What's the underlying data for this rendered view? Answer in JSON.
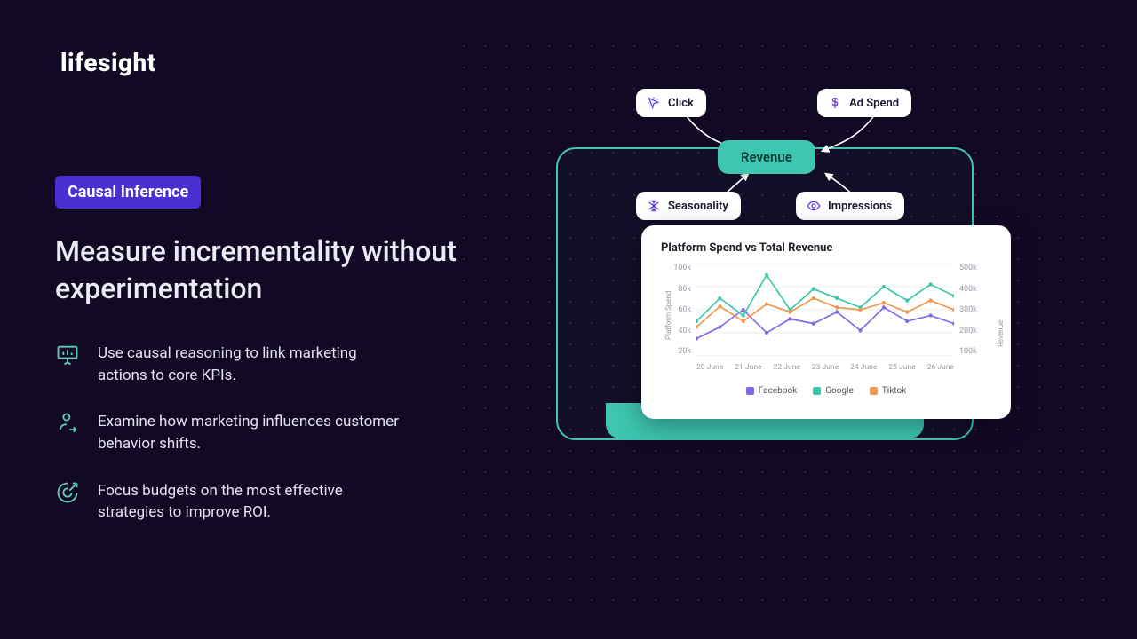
{
  "brand": {
    "name": "lifesight"
  },
  "badge": {
    "label": "Causal Inference"
  },
  "headline": "Measure incrementality without experimentation",
  "bullets": [
    {
      "text": "Use causal reasoning to link marketing actions to core KPIs."
    },
    {
      "text": "Examine how marketing influences customer behavior shifts."
    },
    {
      "text": "Focus budgets on the most effective strategies to improve ROI."
    }
  ],
  "graph_nodes": {
    "click": {
      "label": "Click",
      "icon": "cursor-icon"
    },
    "adspend": {
      "label": "Ad Spend",
      "icon": "dollar-icon"
    },
    "revenue": {
      "label": "Revenue"
    },
    "seasonality": {
      "label": "Seasonality",
      "icon": "snowflake-icon"
    },
    "impressions": {
      "label": "Impressions",
      "icon": "eye-icon"
    }
  },
  "chart_data": {
    "type": "line",
    "title": "Platform Spend vs Total Revenue",
    "xlabel": "",
    "ylabel_left": "Platform Spend",
    "ylabel_right": "Revenue",
    "ylim_left": [
      20,
      100
    ],
    "ylim_right": [
      100,
      500
    ],
    "y_left_ticks": [
      "100k",
      "80k",
      "60k",
      "40k",
      "20k"
    ],
    "y_right_ticks": [
      "500k",
      "400k",
      "300k",
      "200k",
      "100k"
    ],
    "categories": [
      "20 June",
      "21 June",
      "22 June",
      "23 June",
      "24 June",
      "25 June",
      "26 June"
    ],
    "series": [
      {
        "name": "Facebook",
        "color": "#8465ee",
        "values": [
          35,
          45,
          60,
          40,
          52,
          48,
          58,
          42,
          62,
          50,
          55,
          48
        ]
      },
      {
        "name": "Google",
        "color": "#34c7a9",
        "values": [
          50,
          70,
          55,
          90,
          60,
          78,
          70,
          62,
          80,
          68,
          82,
          72
        ]
      },
      {
        "name": "Tiktok",
        "color": "#f2954a",
        "values": [
          45,
          63,
          50,
          65,
          58,
          70,
          62,
          60,
          66,
          58,
          68,
          60
        ]
      }
    ],
    "legend": [
      "Facebook",
      "Google",
      "Tiktok"
    ],
    "legend_colors": {
      "Facebook": "#8465ee",
      "Google": "#34c7a9",
      "Tiktok": "#f2954a"
    }
  }
}
